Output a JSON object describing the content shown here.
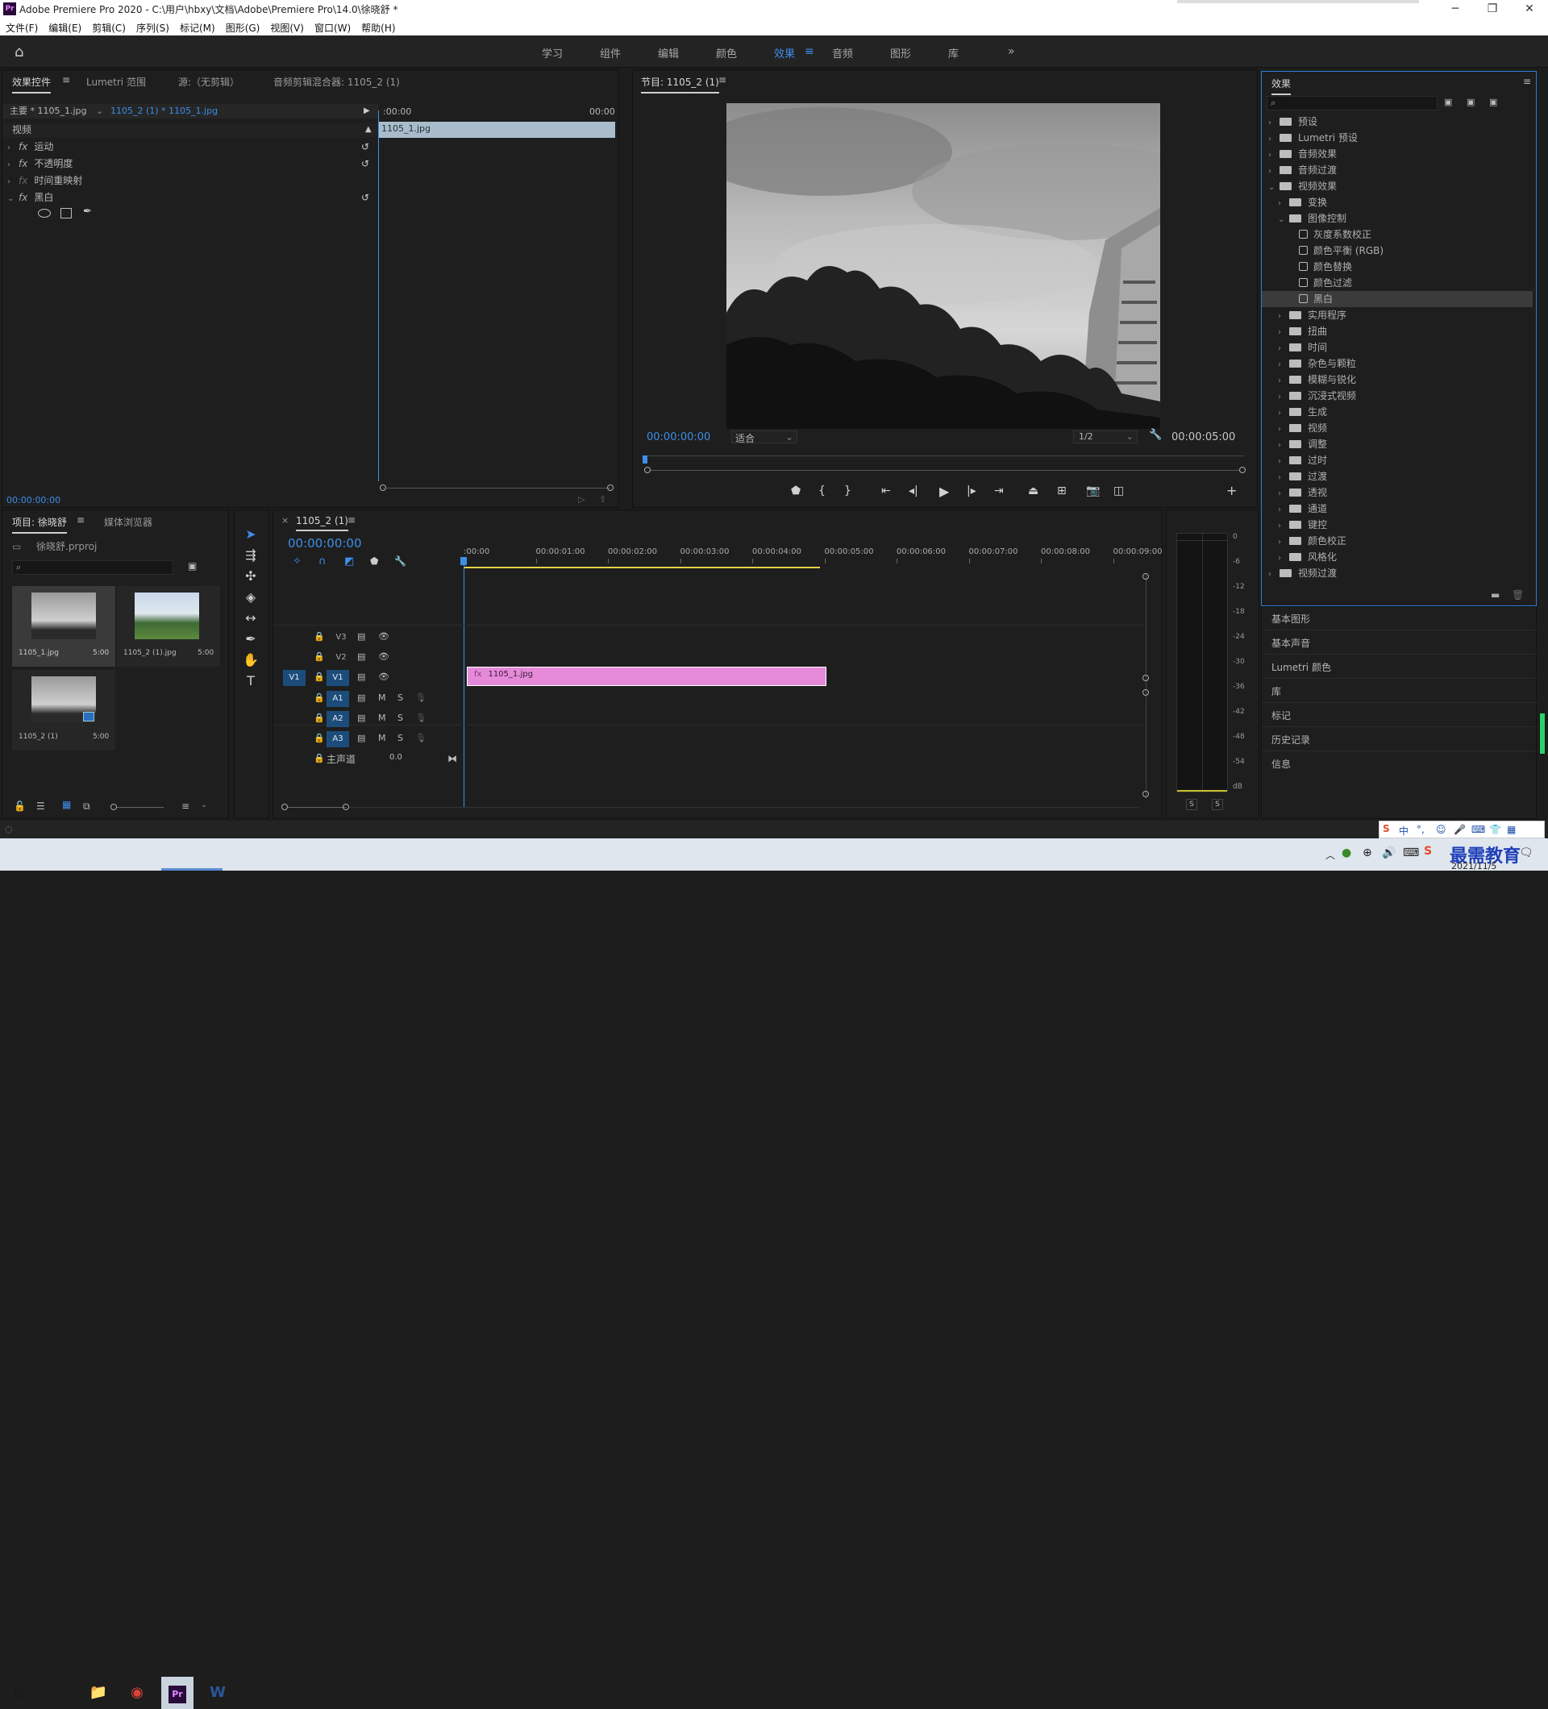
{
  "app": {
    "title": "Adobe Premiere Pro 2020 - C:\\用户\\hbxy\\文档\\Adobe\\Premiere Pro\\14.0\\徐晓舒 *",
    "icon_label": "Pr"
  },
  "menu": [
    "文件(F)",
    "编辑(E)",
    "剪辑(C)",
    "序列(S)",
    "标记(M)",
    "图形(G)",
    "视图(V)",
    "窗口(W)",
    "帮助(H)"
  ],
  "workspaces": [
    "学习",
    "组件",
    "编辑",
    "颜色",
    "效果",
    "音频",
    "图形",
    "库"
  ],
  "workspace_active": "效果",
  "effect_controls": {
    "tabs": [
      "效果控件",
      "Lumetri 范围",
      "源:（无剪辑）",
      "音频剪辑混合器: 1105_2 (1)"
    ],
    "master": "主要 * 1105_1.jpg",
    "sequence": "1105_2 (1) * 1105_1.jpg",
    "time_start": ":00:00",
    "time_end": "00:00",
    "clip_name": "1105_1.jpg",
    "section": "视频",
    "effects": [
      {
        "label": "运动",
        "fx": "fx"
      },
      {
        "label": "不透明度",
        "fx": "fx"
      },
      {
        "label": "时间重映射",
        "fx": "fx"
      },
      {
        "label": "黑白",
        "fx": "fx"
      }
    ],
    "timecode": "00:00:00:00"
  },
  "program": {
    "title": "节目: 1105_2 (1)",
    "timecode": "00:00:00:00",
    "fit": "适合",
    "resolution": "1/2",
    "duration": "00:00:05:00"
  },
  "effects_panel": {
    "title": "效果",
    "tree": [
      {
        "label": "预设",
        "level": 0,
        "type": "folder",
        "open": false
      },
      {
        "label": "Lumetri 预设",
        "level": 0,
        "type": "folder",
        "open": false
      },
      {
        "label": "音频效果",
        "level": 0,
        "type": "folder",
        "open": false
      },
      {
        "label": "音频过渡",
        "level": 0,
        "type": "folder",
        "open": false
      },
      {
        "label": "视频效果",
        "level": 0,
        "type": "folder",
        "open": true
      },
      {
        "label": "变换",
        "level": 1,
        "type": "folder",
        "open": false
      },
      {
        "label": "图像控制",
        "level": 1,
        "type": "folder",
        "open": true
      },
      {
        "label": "灰度系数校正",
        "level": 2,
        "type": "fx"
      },
      {
        "label": "颜色平衡 (RGB)",
        "level": 2,
        "type": "fx"
      },
      {
        "label": "颜色替换",
        "level": 2,
        "type": "fx"
      },
      {
        "label": "颜色过滤",
        "level": 2,
        "type": "fx"
      },
      {
        "label": "黑白",
        "level": 2,
        "type": "fx",
        "selected": true
      },
      {
        "label": "实用程序",
        "level": 1,
        "type": "folder",
        "open": false
      },
      {
        "label": "扭曲",
        "level": 1,
        "type": "folder",
        "open": false
      },
      {
        "label": "时间",
        "level": 1,
        "type": "folder",
        "open": false
      },
      {
        "label": "杂色与颗粒",
        "level": 1,
        "type": "folder",
        "open": false
      },
      {
        "label": "模糊与锐化",
        "level": 1,
        "type": "folder",
        "open": false
      },
      {
        "label": "沉浸式视频",
        "level": 1,
        "type": "folder",
        "open": false
      },
      {
        "label": "生成",
        "level": 1,
        "type": "folder",
        "open": false
      },
      {
        "label": "视频",
        "level": 1,
        "type": "folder",
        "open": false
      },
      {
        "label": "调整",
        "level": 1,
        "type": "folder",
        "open": false
      },
      {
        "label": "过时",
        "level": 1,
        "type": "folder",
        "open": false
      },
      {
        "label": "过渡",
        "level": 1,
        "type": "folder",
        "open": false
      },
      {
        "label": "透视",
        "level": 1,
        "type": "folder",
        "open": false
      },
      {
        "label": "通道",
        "level": 1,
        "type": "folder",
        "open": false
      },
      {
        "label": "键控",
        "level": 1,
        "type": "folder",
        "open": false
      },
      {
        "label": "颜色校正",
        "level": 1,
        "type": "folder",
        "open": false
      },
      {
        "label": "风格化",
        "level": 1,
        "type": "folder",
        "open": false
      },
      {
        "label": "视频过渡",
        "level": 0,
        "type": "folder",
        "open": false
      }
    ],
    "side_panels": [
      "基本图形",
      "基本声音",
      "Lumetri 颜色",
      "库",
      "标记",
      "历史记录",
      "信息"
    ]
  },
  "project": {
    "tabs": [
      "项目: 徐晓舒",
      "媒体浏览器"
    ],
    "file": "徐晓舒.prproj",
    "items": [
      {
        "name": "1105_1.jpg",
        "dur": "5:00"
      },
      {
        "name": "1105_2 (1).jpg",
        "dur": "5:00"
      },
      {
        "name": "1105_2 (1)",
        "dur": "5:00"
      }
    ]
  },
  "timeline": {
    "tab": "1105_2 (1)",
    "timecode": "00:00:00:00",
    "ruler": [
      ":00:00",
      "00:00:01:00",
      "00:00:02:00",
      "00:00:03:00",
      "00:00:04:00",
      "00:00:05:00",
      "00:00:06:00",
      "00:00:07:00",
      "00:00:08:00",
      "00:00:09:00"
    ],
    "video_tracks": [
      "V3",
      "V2",
      "V1"
    ],
    "audio_tracks": [
      "A1",
      "A2",
      "A3"
    ],
    "source_patch": "V1",
    "master": "主声道",
    "master_value": "0.0",
    "clip": "1105_1.jpg",
    "clip_fx": "fx"
  },
  "meter": {
    "scale": [
      "0",
      "-6",
      "-12",
      "-18",
      "-24",
      "-30",
      "-36",
      "-42",
      "-48",
      "-54",
      "dB"
    ],
    "solo": [
      "S",
      "S"
    ]
  },
  "taskbar": {
    "date": "2021/11/5",
    "watermark": "最需教育",
    "ime": "中"
  }
}
